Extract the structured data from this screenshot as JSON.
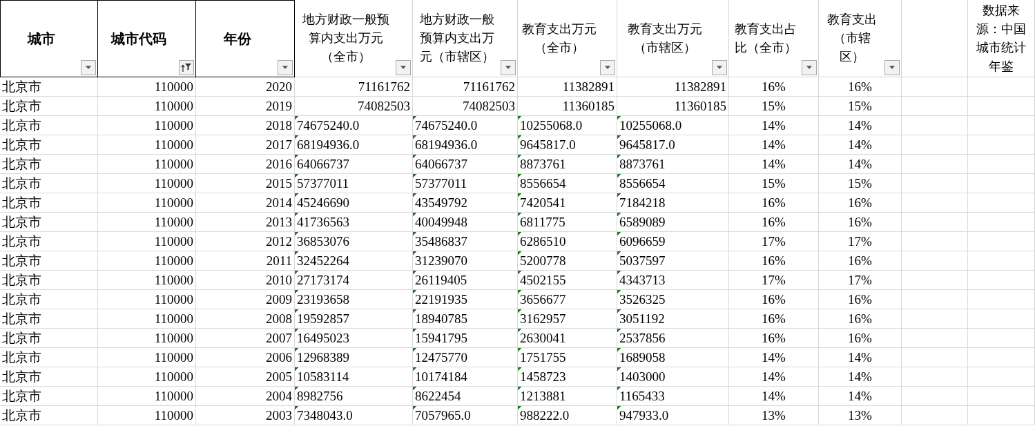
{
  "columns": [
    {
      "label": "城市",
      "bold": true,
      "filter_button": true,
      "sorted": false
    },
    {
      "label": "城市代码",
      "bold": true,
      "filter_button": true,
      "sorted": true
    },
    {
      "label": "年份",
      "bold": true,
      "filter_button": true,
      "sorted": false
    },
    {
      "label": "地方财政一般预算内支出万元（全市）",
      "bold": false,
      "filter_button": true,
      "sorted": false
    },
    {
      "label": "地方财政一般预算内支出万元（市辖区）",
      "bold": false,
      "filter_button": true,
      "sorted": false
    },
    {
      "label": "教育支出万元（全市）",
      "bold": false,
      "filter_button": true,
      "sorted": false
    },
    {
      "label": "教育支出万元（市辖区）",
      "bold": false,
      "filter_button": true,
      "sorted": false
    },
    {
      "label": "教育支出占比（全市）",
      "bold": false,
      "filter_button": true,
      "sorted": false
    },
    {
      "label": "教育支出（市辖区）",
      "bold": false,
      "filter_button": true,
      "sorted": false
    },
    {
      "filter_button": false
    },
    {
      "label": "数据来源：中国城市统计年鉴",
      "bold": false,
      "filter_button": false
    }
  ],
  "rows": [
    {
      "cells": [
        "北京市",
        "110000",
        "2020",
        "71161762",
        "71161762",
        "11382891",
        "11382891",
        "16%",
        "16%"
      ],
      "stored_as_text": false
    },
    {
      "cells": [
        "北京市",
        "110000",
        "2019",
        "74082503",
        "74082503",
        "11360185",
        "11360185",
        "15%",
        "15%"
      ],
      "stored_as_text": false
    },
    {
      "cells": [
        "北京市",
        "110000",
        "2018",
        "74675240.0",
        "74675240.0",
        "10255068.0",
        "10255068.0",
        "14%",
        "14%"
      ],
      "stored_as_text": true
    },
    {
      "cells": [
        "北京市",
        "110000",
        "2017",
        "68194936.0",
        "68194936.0",
        "9645817.0",
        "9645817.0",
        "14%",
        "14%"
      ],
      "stored_as_text": true
    },
    {
      "cells": [
        "北京市",
        "110000",
        "2016",
        "64066737",
        "64066737",
        "8873761",
        "8873761",
        "14%",
        "14%"
      ],
      "stored_as_text": true
    },
    {
      "cells": [
        "北京市",
        "110000",
        "2015",
        "57377011",
        "57377011",
        "8556654",
        "8556654",
        "15%",
        "15%"
      ],
      "stored_as_text": true
    },
    {
      "cells": [
        "北京市",
        "110000",
        "2014",
        "45246690",
        "43549792",
        "7420541",
        "7184218",
        "16%",
        "16%"
      ],
      "stored_as_text": true
    },
    {
      "cells": [
        "北京市",
        "110000",
        "2013",
        "41736563",
        "40049948",
        "6811775",
        "6589089",
        "16%",
        "16%"
      ],
      "stored_as_text": true
    },
    {
      "cells": [
        "北京市",
        "110000",
        "2012",
        "36853076",
        "35486837",
        "6286510",
        "6096659",
        "17%",
        "17%"
      ],
      "stored_as_text": true
    },
    {
      "cells": [
        "北京市",
        "110000",
        "2011",
        "32452264",
        "31239070",
        "5200778",
        "5037597",
        "16%",
        "16%"
      ],
      "stored_as_text": true
    },
    {
      "cells": [
        "北京市",
        "110000",
        "2010",
        "27173174",
        "26119405",
        "4502155",
        "4343713",
        "17%",
        "17%"
      ],
      "stored_as_text": true
    },
    {
      "cells": [
        "北京市",
        "110000",
        "2009",
        "23193658",
        "22191935",
        "3656677",
        "3526325",
        "16%",
        "16%"
      ],
      "stored_as_text": true
    },
    {
      "cells": [
        "北京市",
        "110000",
        "2008",
        "19592857",
        "18940785",
        "3162957",
        "3051192",
        "16%",
        "16%"
      ],
      "stored_as_text": true
    },
    {
      "cells": [
        "北京市",
        "110000",
        "2007",
        "16495023",
        "15941795",
        "2630041",
        "2537856",
        "16%",
        "16%"
      ],
      "stored_as_text": true
    },
    {
      "cells": [
        "北京市",
        "110000",
        "2006",
        "12968389",
        "12475770",
        "1751755",
        "1689058",
        "14%",
        "14%"
      ],
      "stored_as_text": true
    },
    {
      "cells": [
        "北京市",
        "110000",
        "2005",
        "10583114",
        "10174184",
        "1458723",
        "1403000",
        "14%",
        "14%"
      ],
      "stored_as_text": true
    },
    {
      "cells": [
        "北京市",
        "110000",
        "2004",
        "8982756",
        "8622454",
        "1213881",
        "1165433",
        "14%",
        "14%"
      ],
      "stored_as_text": true
    },
    {
      "cells": [
        "北京市",
        "110000",
        "2003",
        "7348043.0",
        "7057965.0",
        "988222.0",
        "947933.0",
        "13%",
        "13%"
      ],
      "stored_as_text": true
    }
  ]
}
